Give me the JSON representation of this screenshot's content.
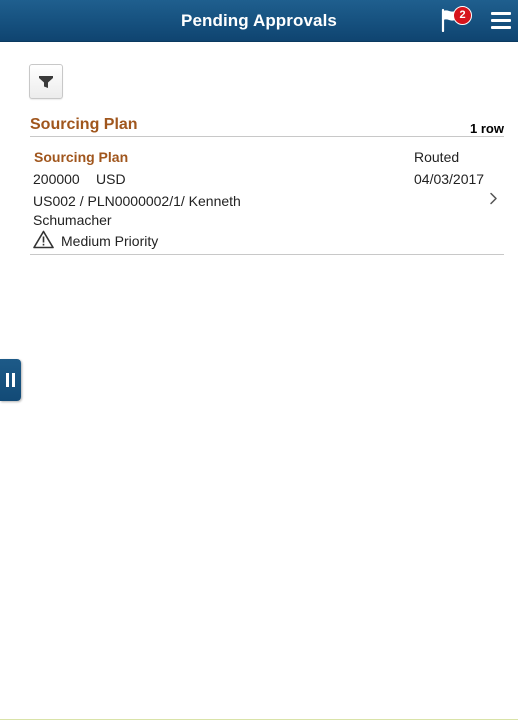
{
  "header": {
    "title": "Pending Approvals",
    "notification_count": "2",
    "notification_icon": "flag-icon",
    "menu_icon": "hamburger-menu-icon"
  },
  "toolbar": {
    "filter_icon": "filter-icon"
  },
  "section": {
    "title": "Sourcing Plan",
    "row_count": "1 row"
  },
  "items": [
    {
      "title": "Sourcing Plan",
      "status": "Routed",
      "amount": "200000",
      "currency": "USD",
      "date": "04/03/2017",
      "description": "US002 / PLN0000002/1/ Kenneth Schumacher",
      "priority": "Medium Priority",
      "priority_icon": "warning-icon"
    }
  ],
  "colors": {
    "header_bg": "#154f7d",
    "accent_text": "#a0561d",
    "badge": "#d6141c"
  }
}
